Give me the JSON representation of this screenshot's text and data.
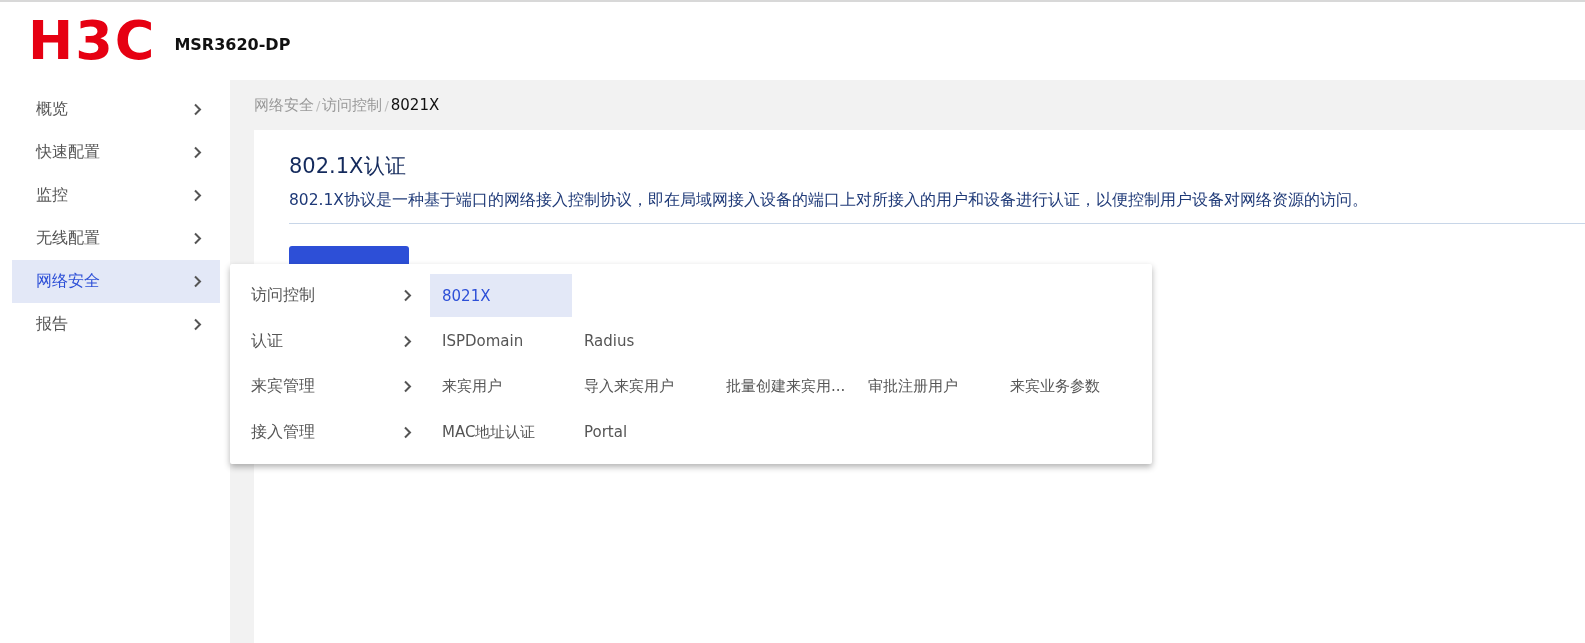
{
  "header": {
    "logo": "H3C",
    "device": "MSR3620-DP"
  },
  "sidebar": {
    "items": [
      {
        "label": "概览",
        "selected": false
      },
      {
        "label": "快速配置",
        "selected": false
      },
      {
        "label": "监控",
        "selected": false
      },
      {
        "label": "无线配置",
        "selected": false
      },
      {
        "label": "网络安全",
        "selected": true
      },
      {
        "label": "报告",
        "selected": false
      }
    ]
  },
  "breadcrumb": [
    {
      "label": "网络安全",
      "current": false
    },
    {
      "label": "访问控制",
      "current": false
    },
    {
      "label": "8021X",
      "current": true
    }
  ],
  "separator": "/",
  "page": {
    "title": "802.1X认证",
    "description": "802.1X协议是一种基于端口的网络接入控制协议，即在局域网接入设备的端口上对所接入的用户和设备进行认证，以便控制用户设备对网络资源的访问。"
  },
  "flyout": {
    "groups": [
      {
        "label": "访问控制",
        "items": [
          {
            "label": "8021X",
            "selected": true
          }
        ]
      },
      {
        "label": "认证",
        "items": [
          {
            "label": "ISPDomain",
            "selected": false
          },
          {
            "label": "Radius",
            "selected": false
          }
        ]
      },
      {
        "label": "来宾管理",
        "items": [
          {
            "label": "来宾用户",
            "selected": false
          },
          {
            "label": "导入来宾用户",
            "selected": false
          },
          {
            "label": "批量创建来宾用...",
            "selected": false
          },
          {
            "label": "审批注册用户",
            "selected": false
          },
          {
            "label": "来宾业务参数",
            "selected": false
          }
        ]
      },
      {
        "label": "接入管理",
        "items": [
          {
            "label": "MAC地址认证",
            "selected": false
          },
          {
            "label": "Portal",
            "selected": false
          }
        ]
      }
    ]
  }
}
